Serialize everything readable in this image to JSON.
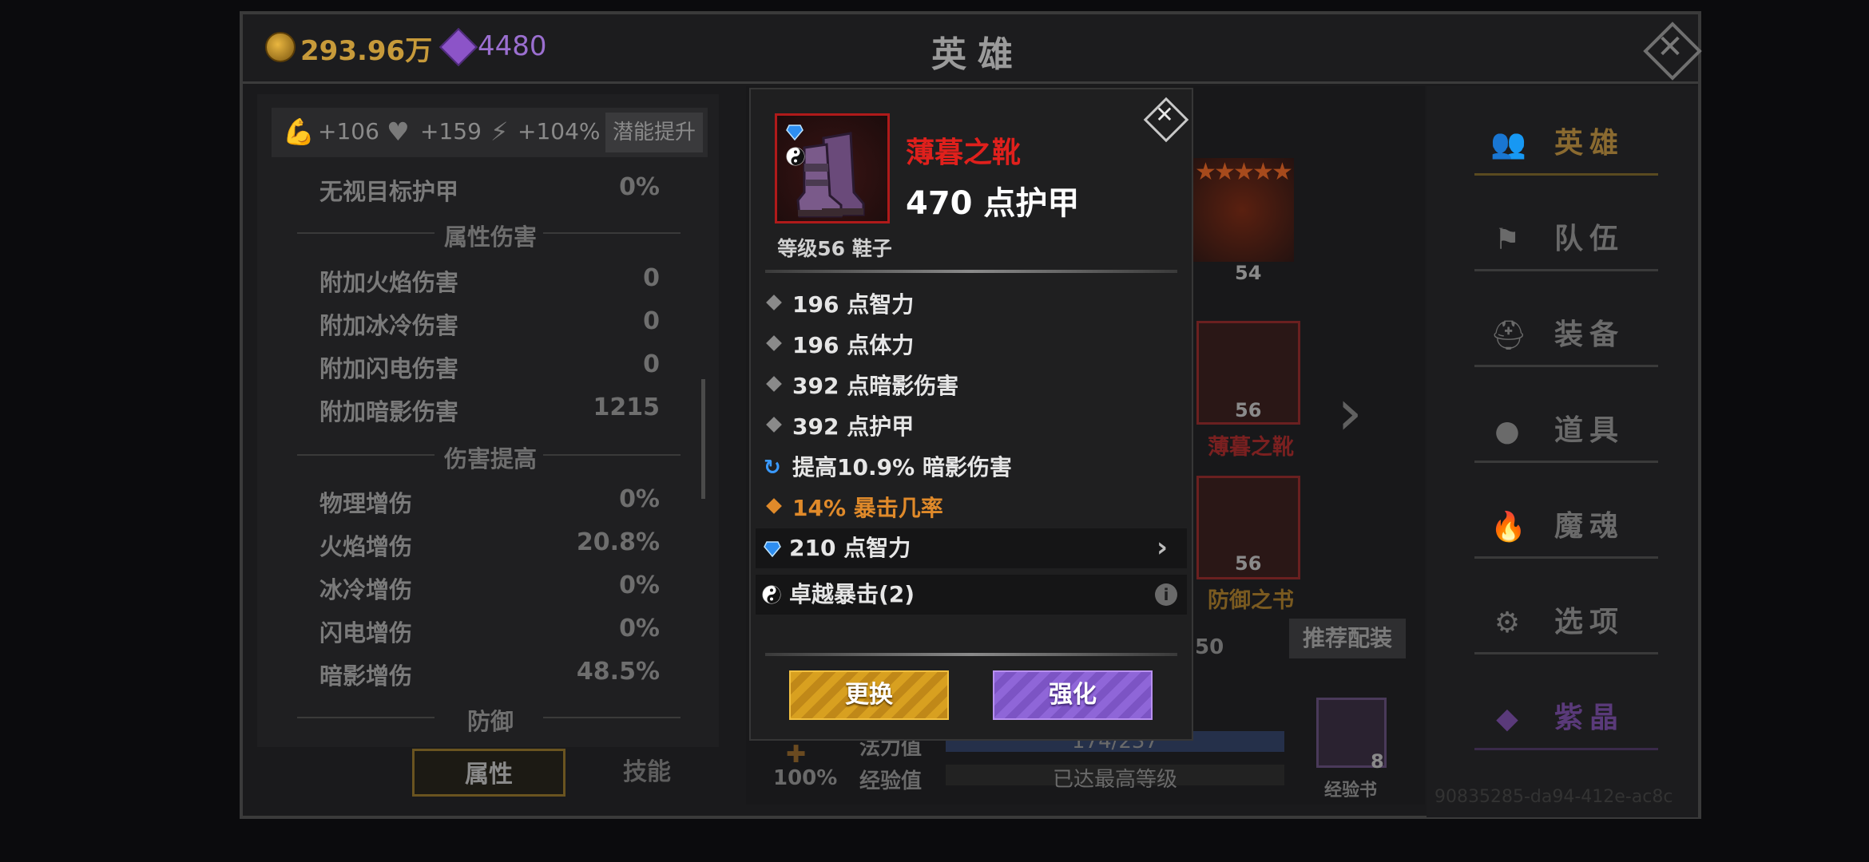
{
  "currency": {
    "gold": "293.96万",
    "gems": "4480"
  },
  "window_title": "英雄",
  "bonus_bar": {
    "strength": "+106",
    "health": "+159",
    "energy": "+104%",
    "potential_button": "潜能提升"
  },
  "stats": {
    "ignore_armor": {
      "name": "无视目标护甲",
      "value": "0%"
    },
    "section_elemental": "属性伤害",
    "elemental": [
      {
        "name": "附加火焰伤害",
        "value": "0"
      },
      {
        "name": "附加冰冷伤害",
        "value": "0"
      },
      {
        "name": "附加闪电伤害",
        "value": "0"
      },
      {
        "name": "附加暗影伤害",
        "value": "1215"
      }
    ],
    "section_damage_up": "伤害提高",
    "damage_up": [
      {
        "name": "物理增伤",
        "value": "0%"
      },
      {
        "name": "火焰增伤",
        "value": "20.8%"
      },
      {
        "name": "冰冷增伤",
        "value": "0%"
      },
      {
        "name": "闪电增伤",
        "value": "0%"
      },
      {
        "name": "暗影增伤",
        "value": "48.5%"
      }
    ],
    "section_defense": "防御"
  },
  "left_tabs": {
    "attributes": "属性",
    "skills": "技能"
  },
  "hero_area": {
    "hero_level": "54",
    "slot_boots": {
      "level": "56",
      "name": "薄暮之靴"
    },
    "slot_book": {
      "level": "56",
      "name": "防御之书"
    },
    "recommend_button": "推荐配装",
    "partial_value": "50",
    "bars": [
      {
        "label": "法力值",
        "value": "174/237"
      },
      {
        "label": "经验值",
        "value": "已达最高等级"
      }
    ],
    "percent": "100%",
    "exp_book": {
      "label": "经验书",
      "count": "8"
    }
  },
  "menu": [
    {
      "label": "英雄",
      "icon": "users-icon"
    },
    {
      "label": "队伍",
      "icon": "flag-icon"
    },
    {
      "label": "装备",
      "icon": "helmet-icon"
    },
    {
      "label": "道具",
      "icon": "bag-icon"
    },
    {
      "label": "魔魂",
      "icon": "flame-icon"
    },
    {
      "label": "选项",
      "icon": "gear-icon"
    },
    {
      "label": "紫晶",
      "icon": "crystal-icon"
    }
  ],
  "uid": "90835285-da94-412e-ac8c",
  "popup": {
    "item_name": "薄暮之靴",
    "item_armor": "470 点护甲",
    "item_level": "等级56 鞋子",
    "attributes": [
      {
        "text": "196 点智力",
        "type": "base"
      },
      {
        "text": "196 点体力",
        "type": "base"
      },
      {
        "text": "392 点暗影伤害",
        "type": "base"
      },
      {
        "text": "392 点护甲",
        "type": "base"
      },
      {
        "text": "提高10.9% 暗影伤害",
        "type": "refine"
      },
      {
        "text": "14% 暴击几率",
        "type": "legendary"
      }
    ],
    "gem_line": "210 点智力",
    "set_line": "卓越暴击(2)",
    "buttons": {
      "replace": "更换",
      "enhance": "强化"
    }
  },
  "colors": {
    "item_name": "#e0201c",
    "legendary": "#e08a2a",
    "refine_icon": "#3a9aff",
    "gold_button": "#d8a020",
    "purple_button": "#8f66d8"
  }
}
